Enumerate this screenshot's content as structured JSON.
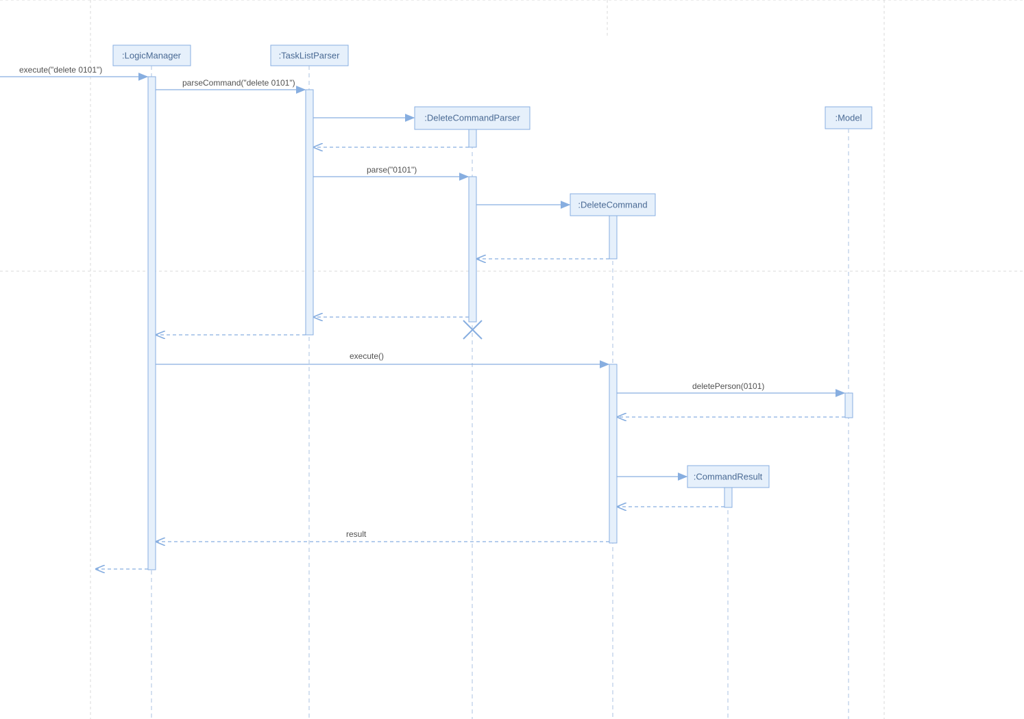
{
  "participants": {
    "logicManager": ":LogicManager",
    "taskListParser": ":TaskListParser",
    "deleteCommandParser": ":DeleteCommandParser",
    "deleteCommand": ":DeleteCommand",
    "model": ":Model",
    "commandResult": ":CommandResult"
  },
  "messages": {
    "execute_in": "execute(\"delete 0101\")",
    "parseCommand": "parseCommand(\"delete 0101\")",
    "parse": "parse(\"0101\")",
    "execute": "execute()",
    "deletePerson": "deletePerson(0101)",
    "result": "result"
  },
  "colors": {
    "boxFill": "#e6f0fb",
    "boxStroke": "#87aee0",
    "frame": "#d9d9d9"
  }
}
